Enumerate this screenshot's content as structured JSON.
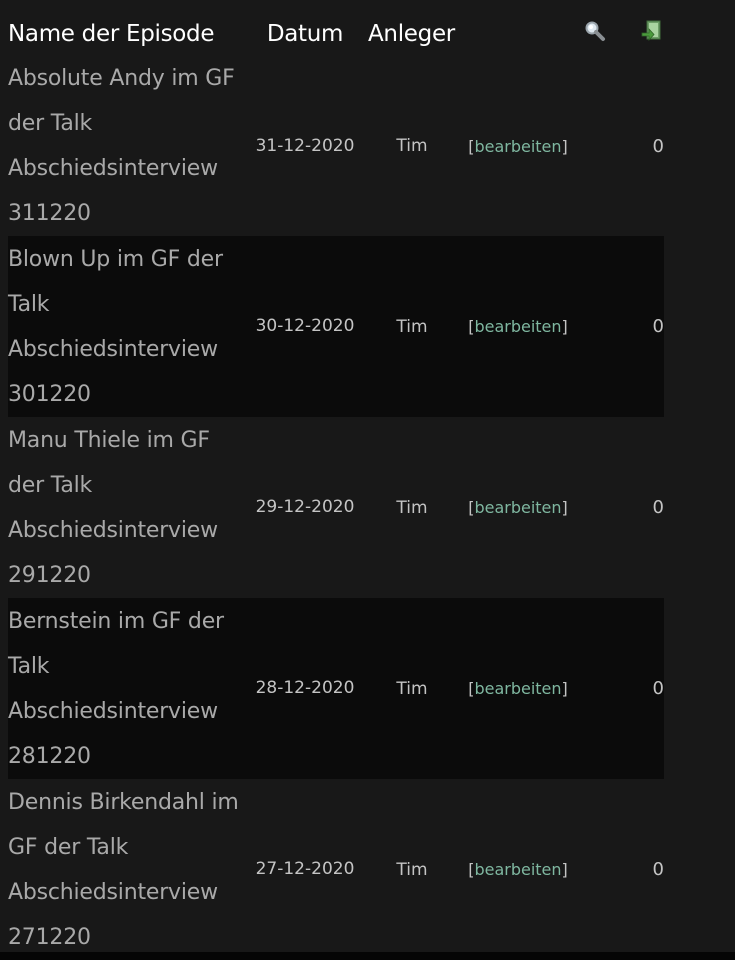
{
  "table": {
    "headers": {
      "name": "Name der Episode",
      "date": "Datum",
      "creator": "Anleger"
    },
    "icons": {
      "search": "search-icon",
      "export": "export-icon"
    },
    "rows": [
      {
        "name": "Absolute Andy im GF der Talk Abschiedsinterview 311220",
        "date": "31-12-2020",
        "creator": "Tim",
        "edit_open": "[",
        "edit": "bearbeiten",
        "edit_close": "]",
        "count": "0"
      },
      {
        "name": "Blown Up im GF der Talk Abschiedsinterview 301220",
        "date": "30-12-2020",
        "creator": "Tim",
        "edit_open": "[",
        "edit": "bearbeiten",
        "edit_close": "]",
        "count": "0"
      },
      {
        "name": "Manu Thiele im GF der Talk Abschiedsinterview 291220",
        "date": "29-12-2020",
        "creator": "Tim",
        "edit_open": "[",
        "edit": "bearbeiten",
        "edit_close": "]",
        "count": "0"
      },
      {
        "name": "Bernstein im GF der Talk Abschiedsinterview 281220",
        "date": "28-12-2020",
        "creator": "Tim",
        "edit_open": "[",
        "edit": "bearbeiten",
        "edit_close": "]",
        "count": "0"
      },
      {
        "name": "Dennis Birkendahl im GF der Talk Abschiedsinterview 271220",
        "date": "27-12-2020",
        "creator": "Tim",
        "edit_open": "[",
        "edit": "bearbeiten",
        "edit_close": "]",
        "count": "0"
      }
    ]
  },
  "colors": {
    "background": "#181818",
    "alt_row": "#0b0b0b",
    "header_text": "#ffffff",
    "body_text": "#c4c4c4",
    "link": "#7fb7a0"
  }
}
